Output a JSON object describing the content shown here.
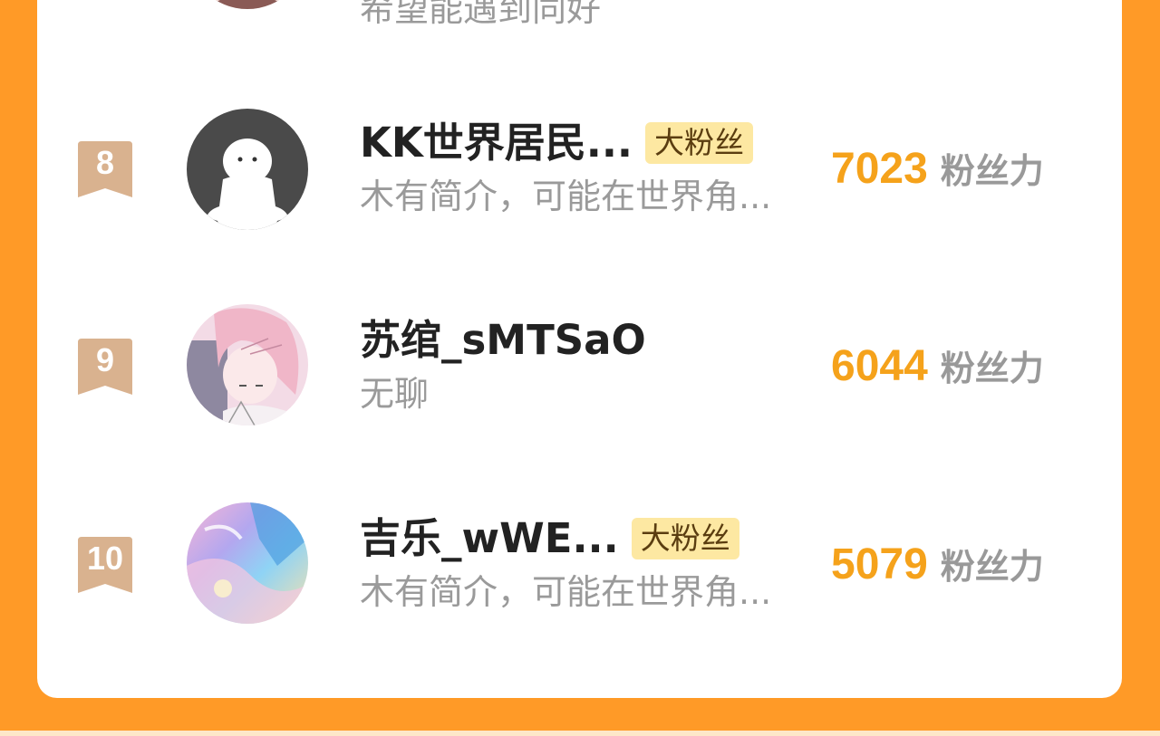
{
  "colors": {
    "background": "#ff9a27",
    "card": "#ffffff",
    "score": "#f5a21b",
    "badge": "#d9b28f",
    "tag_bg": "#fde8a2"
  },
  "partial_row": {
    "bio": "希望能遇到同好"
  },
  "rankings": [
    {
      "rank": "8",
      "name": "KK世界居民...",
      "tag": "大粉丝",
      "bio": "木有简介，可能在世界角...",
      "score": "7023",
      "score_unit": "粉丝力",
      "avatar": "default-avatar-icon"
    },
    {
      "rank": "9",
      "name": "苏绾_sMTSaO",
      "tag": "",
      "bio": "无聊",
      "score": "6044",
      "score_unit": "粉丝力",
      "avatar": "anime-girl-avatar"
    },
    {
      "rank": "10",
      "name": "吉乐_wWE...",
      "tag": "大粉丝",
      "bio": "木有简介，可能在世界角...",
      "score": "5079",
      "score_unit": "粉丝力",
      "avatar": "watercolor-sky-avatar"
    }
  ]
}
